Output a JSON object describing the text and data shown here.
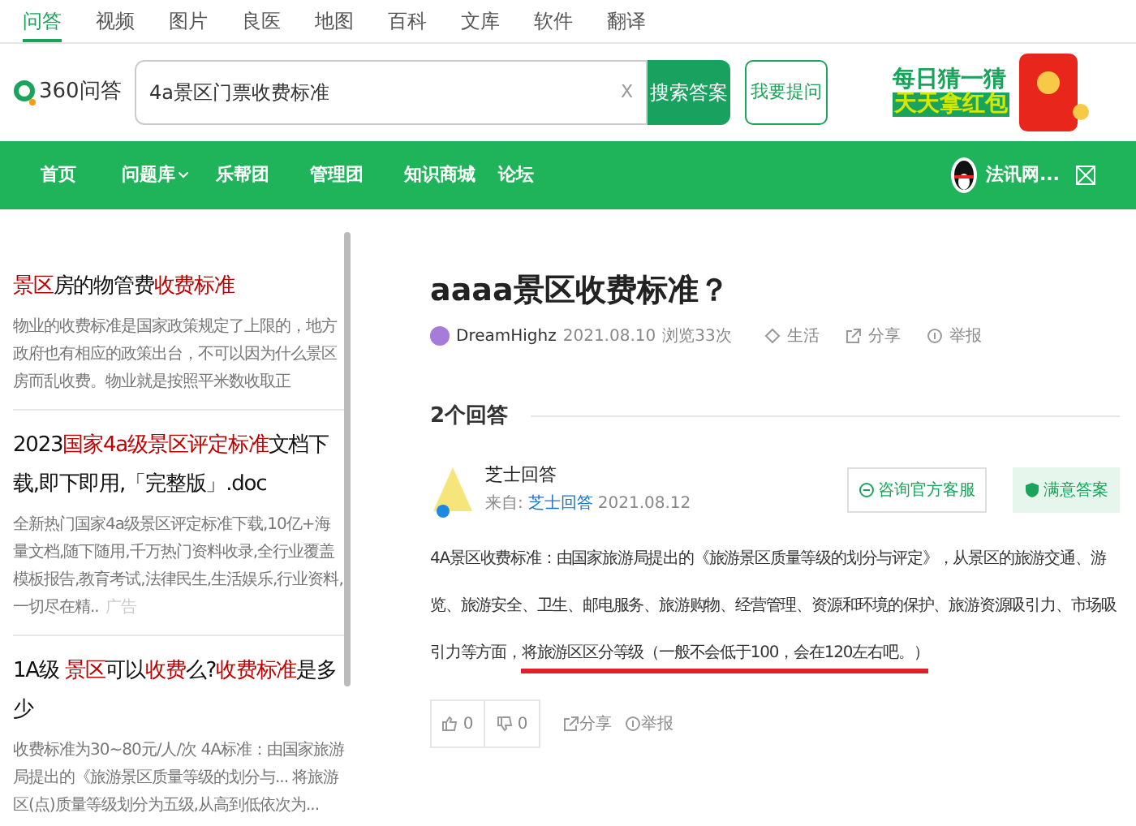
{
  "top_tabs": [
    {
      "label": "问答",
      "selected": true
    },
    {
      "label": "视频",
      "selected": false
    },
    {
      "label": "图片",
      "selected": false
    },
    {
      "label": "良医",
      "selected": false
    },
    {
      "label": "地图",
      "selected": false
    },
    {
      "label": "百科",
      "selected": false
    },
    {
      "label": "文库",
      "selected": false
    },
    {
      "label": "软件",
      "selected": false
    },
    {
      "label": "翻译",
      "selected": false
    }
  ],
  "logo": {
    "text": "360问答"
  },
  "search": {
    "value": "4a景区门票收费标准",
    "clear": "X",
    "button": "搜索答案"
  },
  "ask_button": "我要提问",
  "banner": {
    "line1": "每日猜一猜",
    "line2": "天天拿红包"
  },
  "nav": [
    {
      "label": "首页",
      "dropdown": false
    },
    {
      "label": "问题库",
      "dropdown": true
    },
    {
      "label": "乐帮团",
      "dropdown": false
    },
    {
      "label": "管理团",
      "dropdown": false
    },
    {
      "label": "知识商城",
      "dropdown": false
    },
    {
      "label": "论坛",
      "dropdown": false
    }
  ],
  "user": {
    "name": "法讯网..."
  },
  "sidebar_items": [
    {
      "title": [
        {
          "text": "景区",
          "hl": true
        },
        {
          "text": "房的物管费",
          "hl": false
        },
        {
          "text": "收费标准",
          "hl": true
        }
      ],
      "snippet": "物业的收费标准是国家政策规定了上限的，地方政府也有相应的政策出台，不可以因为什么景区房而乱收费。物业就是按照平米数收取正"
    },
    {
      "title": [
        {
          "text": "2023",
          "hl": false
        },
        {
          "text": "国家4a级景区评定标准",
          "hl": true
        },
        {
          "text": "文档下载,即下即用,「完整版」.doc",
          "hl": false
        }
      ],
      "snippet": "全新热门国家4a级景区评定标准下载,10亿+海量文档,随下随用,千万热门资料收录,全行业覆盖模板报告,教育考试,法律民生,生活娱乐,行业资料,一切尽在精..",
      "ad": "广告"
    },
    {
      "title": [
        {
          "text": "1A级 ",
          "hl": false
        },
        {
          "text": "景区",
          "hl": true
        },
        {
          "text": "可以",
          "hl": false
        },
        {
          "text": "收费",
          "hl": true
        },
        {
          "text": "么?",
          "hl": false
        },
        {
          "text": "收费标准",
          "hl": true
        },
        {
          "text": "是多少",
          "hl": false
        }
      ],
      "snippet": "收费标准为30~80元/人/次 4A标准：由国家旅游局提出的《旅游景区质量等级的划分与... 将旅游区(点)质量等级划分为五级,从高到低依次为..."
    }
  ],
  "question": {
    "title": "aaaa景区收费标准？",
    "author": "DreamHighz",
    "date": "2021.08.10",
    "views": "浏览33次",
    "category": "生活",
    "share": "分享",
    "report": "举报"
  },
  "answers_count": "2个回答",
  "answer": {
    "author": "芝士回答",
    "source_label": "来自:",
    "source": "芝士回答",
    "date": "2021.08.12",
    "consult": "咨询官方客服",
    "satisfied": "满意答案",
    "body": [
      {
        "text": "4A景区收费标准：由国家旅游局提出的《旅游景区质量等级的划分与评定》，从景区的旅游交通、游览、旅游安全、卫生、邮电服务、旅游购物、经营管理、资源和环境的保护、旅游资源吸引力、市场吸引力等方面，",
        "marked": false
      },
      {
        "text": "将旅游区区分等级（一般不会低于100，会在120左右吧。）",
        "marked": true
      }
    ],
    "likes": "0",
    "dislikes": "0",
    "share": "分享",
    "report": "举报"
  }
}
